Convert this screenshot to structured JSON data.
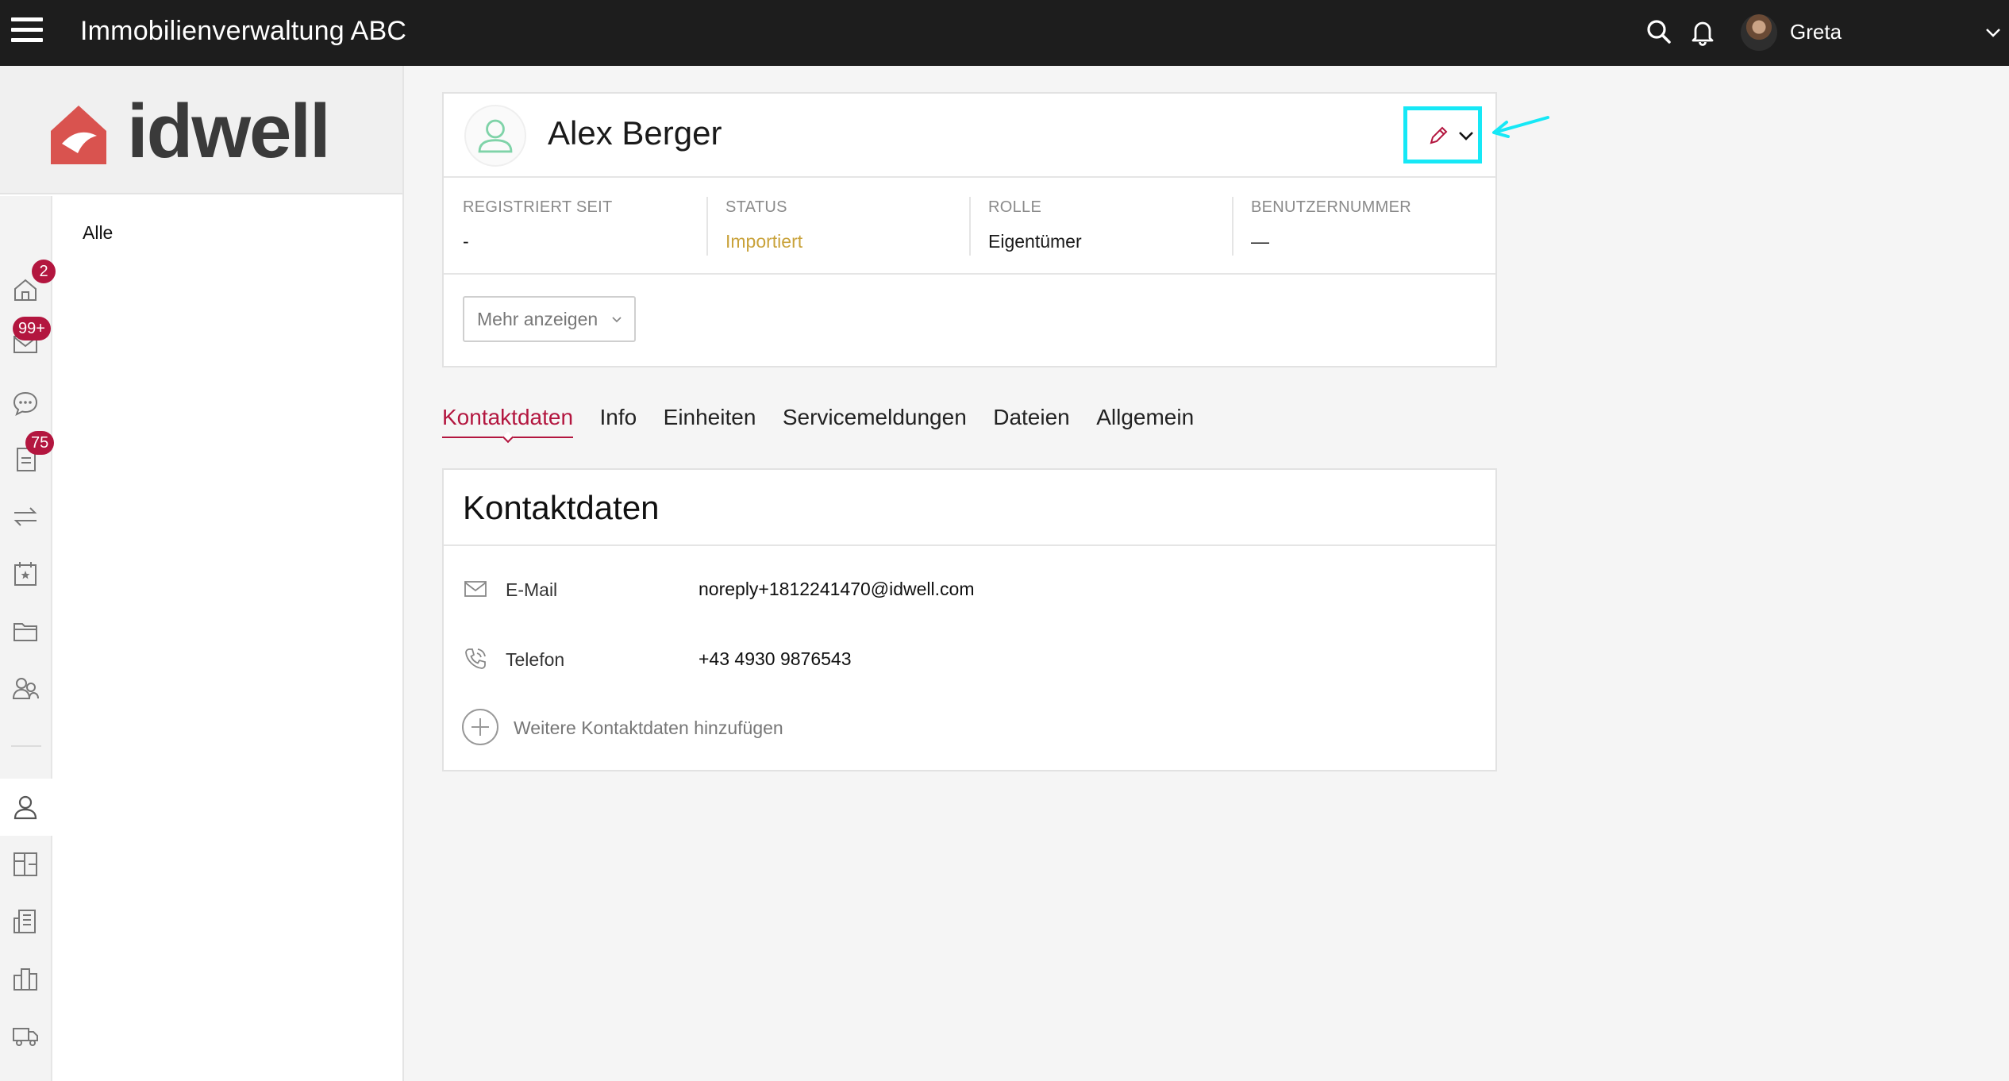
{
  "app": {
    "title": "Immobilienverwaltung ABC"
  },
  "header": {
    "user_name": "Greta"
  },
  "brand": {
    "logo_text": "idwell",
    "logo_color": "#d9534f"
  },
  "sidebar": {
    "badges": {
      "home": "2",
      "mail": "99+",
      "tasks": "75"
    },
    "filter_label": "Alle"
  },
  "profile": {
    "name": "Alex Berger",
    "meta": [
      {
        "label": "REGISTRIERT SEIT",
        "value": "-"
      },
      {
        "label": "STATUS",
        "value": "Importiert"
      },
      {
        "label": "ROLLE",
        "value": "Eigentümer"
      },
      {
        "label": "BENUTZERNUMMER",
        "value": "—"
      }
    ],
    "more_button": "Mehr anzeigen"
  },
  "tabs": [
    {
      "label": "Kontaktdaten",
      "active": true
    },
    {
      "label": "Info"
    },
    {
      "label": "Einheiten"
    },
    {
      "label": "Servicemeldungen"
    },
    {
      "label": "Dateien"
    },
    {
      "label": "Allgemein"
    }
  ],
  "contact": {
    "title": "Kontaktdaten",
    "rows": [
      {
        "icon": "mail-icon",
        "label": "E-Mail",
        "value": "noreply+1812241470@idwell.com"
      },
      {
        "icon": "phone-icon",
        "label": "Telefon",
        "value": "+43 4930 9876543"
      }
    ],
    "add_label": "Weitere Kontaktdaten hinzufügen"
  },
  "colors": {
    "accent": "#b3163f",
    "status_imported": "#c9a23a",
    "highlight": "#16e8f6",
    "topbar": "#1d1d1d"
  }
}
